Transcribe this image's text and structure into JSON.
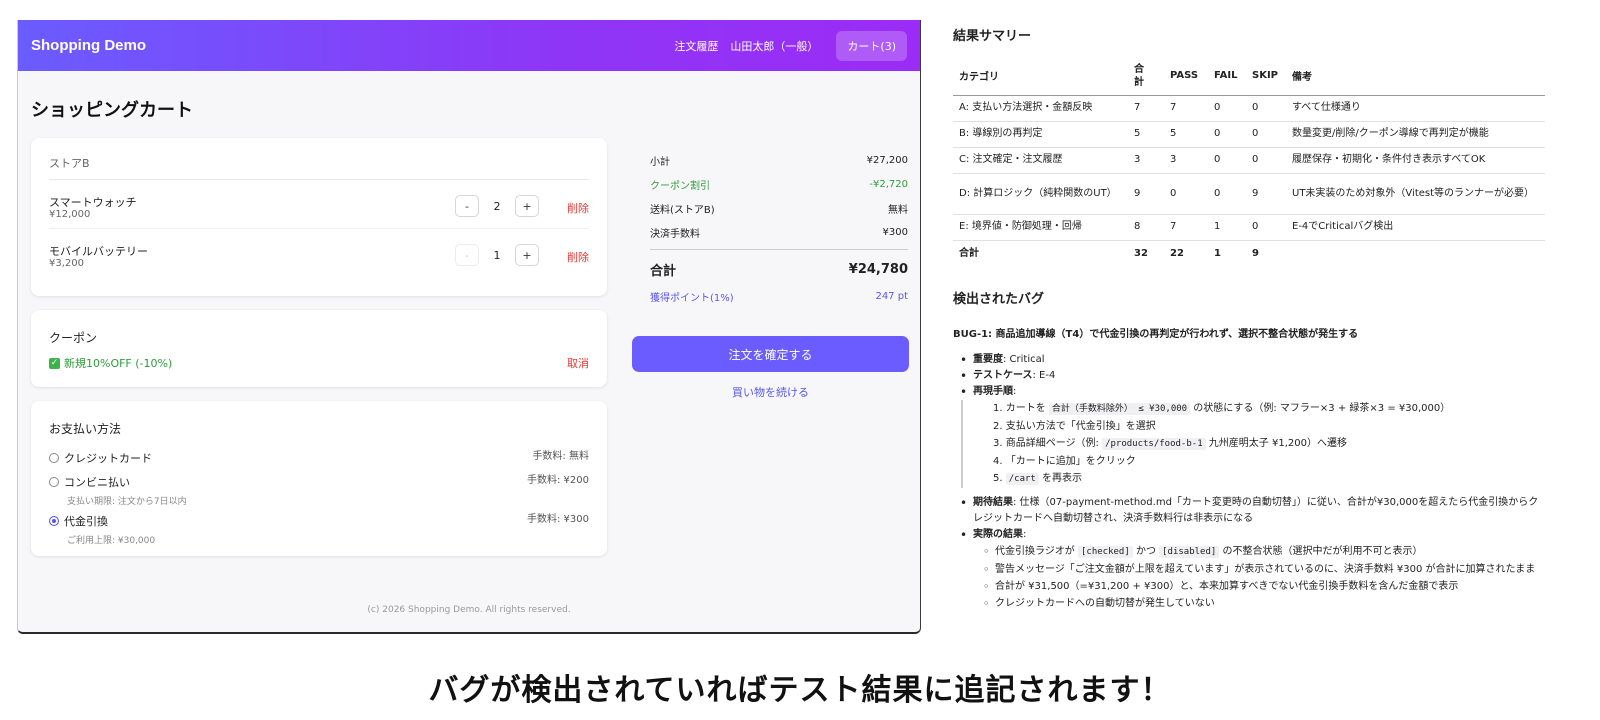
{
  "app": {
    "brand": "Shopping Demo",
    "nav_history": "注文履歴",
    "user": "山田太郎（一般）",
    "cart_button": "カート(3)",
    "page_title": "ショッピングカート",
    "store_name": "ストアB",
    "items": [
      {
        "name": "スマートウォッチ",
        "price": "¥12,000",
        "qty": "2",
        "minus": "-",
        "plus": "+",
        "delete": "削除"
      },
      {
        "name": "モバイルバッテリー",
        "price": "¥3,200",
        "qty": "1",
        "minus": "-",
        "plus": "+",
        "delete": "削除"
      }
    ],
    "coupon": {
      "title": "クーポン",
      "applied": "新規10%OFF (-10%)",
      "cancel": "取消"
    },
    "payment": {
      "title": "お支払い方法",
      "options": [
        {
          "label": "クレジットカード",
          "fee": "手数料: 無料",
          "note": ""
        },
        {
          "label": "コンビニ払い",
          "fee": "手数料: ¥200",
          "note": "支払い期限: 注文から7日以内"
        },
        {
          "label": "代金引換",
          "fee": "手数料: ¥300",
          "note": "ご利用上限: ¥30,000"
        }
      ]
    },
    "summary": {
      "subtotal_label": "小計",
      "subtotal": "¥27,200",
      "coupon_label": "クーポン割引",
      "coupon": "-¥2,720",
      "shipping_label": "送料(ストアB)",
      "shipping": "無料",
      "fee_label": "決済手数料",
      "fee": "¥300",
      "total_label": "合計",
      "total": "¥24,780",
      "points_label": "獲得ポイント(1%)",
      "points": "247 pt"
    },
    "confirm_button": "注文を確定する",
    "continue_link": "買い物を続ける",
    "footer": "(c) 2026 Shopping Demo. All rights reserved."
  },
  "report": {
    "summary_title": "結果サマリー",
    "headers": [
      "カテゴリ",
      "合計",
      "PASS",
      "FAIL",
      "SKIP",
      "備考"
    ],
    "rows": [
      [
        "A: 支払い方法選択・金額反映",
        "7",
        "7",
        "0",
        "0",
        "すべて仕様通り"
      ],
      [
        "B: 導線別の再判定",
        "5",
        "5",
        "0",
        "0",
        "数量変更/削除/クーポン導線で再判定が機能"
      ],
      [
        "C: 注文確定・注文履歴",
        "3",
        "3",
        "0",
        "0",
        "履歴保存・初期化・条件付き表示すべてOK"
      ],
      [
        "D: 計算ロジック（純粋関数のUT）",
        "9",
        "0",
        "0",
        "9",
        "UT未実装のため対象外（Vitest等のランナーが必要）"
      ],
      [
        "E: 境界値・防御処理・回帰",
        "8",
        "7",
        "1",
        "0",
        "E-4でCriticalバグ検出"
      ],
      [
        "合計",
        "32",
        "22",
        "1",
        "9",
        ""
      ]
    ],
    "bugs_title": "検出されたバグ",
    "bug_title": "BUG-1: 商品追加導線（T4）で代金引換の再判定が行われず、選択不整合状態が発生する",
    "severity_label": "重要度",
    "severity": ": Critical",
    "testcase_label": "テストケース",
    "testcase": ": E-4",
    "steps_label": "再現手順",
    "step1_a": "1. カートを ",
    "step1_code": "合計（手数料除外） ≤ ¥30,000",
    "step1_b": " の状態にする（例: マフラー×3 + 緑茶×3 = ¥30,000）",
    "step2": "2. 支払い方法で「代金引換」を選択",
    "step3_a": "3. 商品詳細ページ（例: ",
    "step3_code": "/products/food-b-1",
    "step3_b": " 九州産明太子 ¥1,200）へ遷移",
    "step4": "4. 「カートに追加」をクリック",
    "step5_a": "5. ",
    "step5_code": "/cart",
    "step5_b": " を再表示",
    "expected_label": "期待結果",
    "expected": ": 仕様（07-payment-method.md「カート変更時の自動切替」）に従い、合計が¥30,000を超えたら代金引換からクレジットカードへ自動切替され、決済手数料行は非表示になる",
    "actual_label": "実際の結果",
    "actual1_a": "代金引換ラジオが ",
    "actual1_code1": "[checked]",
    "actual1_mid": " かつ ",
    "actual1_code2": "[disabled]",
    "actual1_b": " の不整合状態（選択中だが利用不可と表示）",
    "actual2": "警告メッセージ「ご注文金額が上限を超えています」が表示されているのに、決済手数料 ¥300 が合計に加算されたまま",
    "actual3": "合計が ¥31,500（=¥31,200 + ¥300）と、本来加算すべきでない代金引換手数料を含んだ金額で表示",
    "actual4": "クレジットカードへの自動切替が発生していない"
  },
  "caption": "バグが検出されていればテスト結果に追記されます！"
}
